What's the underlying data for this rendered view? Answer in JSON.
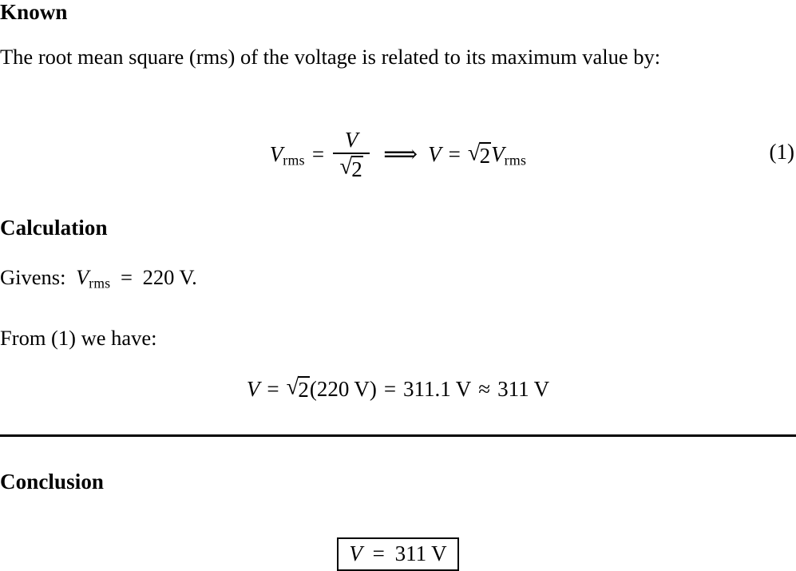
{
  "document": {
    "type": "physics-solution",
    "background_color": "#ffffff",
    "text_color": "#000000"
  },
  "sections": {
    "known": {
      "heading": "Known",
      "paragraph": "The root mean square (rms) of the voltage is related to its maximum value by:",
      "equation": {
        "number": "(1)",
        "lhs_symbol": "V",
        "lhs_subscript": "rms",
        "equals": "=",
        "fraction_numerator": "V",
        "fraction_denominator_radical": "√",
        "fraction_denominator_radicand": "2",
        "implies": "⟹",
        "rhs_symbol": "V",
        "rhs_equals": "=",
        "rhs_radical": "√",
        "rhs_radicand": "2",
        "rhs_factor_symbol": "V",
        "rhs_factor_subscript": "rms",
        "plain_text": "V_rms = V / √2  ⟹  V = √2 V_rms"
      }
    },
    "calculation": {
      "heading": "Calculation",
      "givens_label": "Givens:",
      "givens_symbol": "V",
      "givens_subscript": "rms",
      "givens_equals": "=",
      "givens_value": "220",
      "givens_unit": "V",
      "givens_terminator": ".",
      "from_line": "From (1) we have:",
      "equation": {
        "symbol": "V",
        "equals": "=",
        "radical": "√",
        "radicand": "2",
        "open_paren": "(",
        "input_value": "220",
        "input_unit": "V",
        "close_paren": ")",
        "equals_2": "=",
        "result_value": "311.1",
        "result_unit": "V",
        "approx": "≈",
        "rounded_value": "311",
        "rounded_unit": "V",
        "plain_text": "V = √2(220 V) = 311.1 V ≈ 311 V"
      }
    },
    "conclusion": {
      "heading": "Conclusion",
      "boxed_answer": {
        "symbol": "V",
        "equals": "=",
        "value": "311",
        "unit": "V",
        "plain_text": "V = 311 V"
      }
    }
  }
}
